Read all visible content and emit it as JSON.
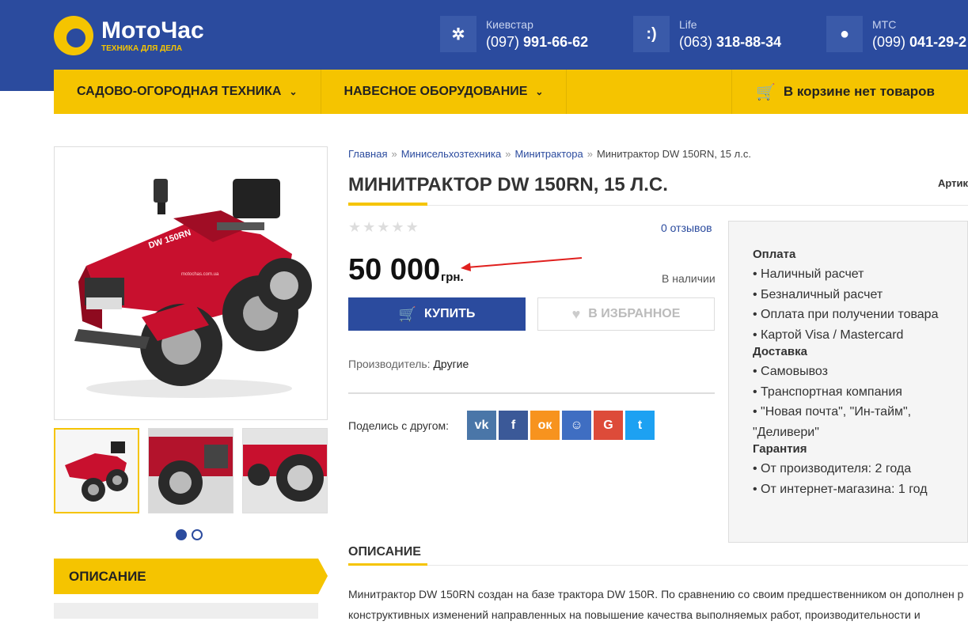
{
  "brand": {
    "name": "МотоЧас",
    "slogan": "Техника для дела"
  },
  "phones": [
    {
      "operator": "Киевстар",
      "code": "(097)",
      "number": "991-66-62",
      "icon": "kyivstar-icon",
      "glyph": "✲"
    },
    {
      "operator": "Life",
      "code": "(063)",
      "number": "318-88-34",
      "icon": "life-icon",
      "glyph": ":)"
    },
    {
      "operator": "МТС",
      "code": "(099)",
      "number": "041-29-2",
      "icon": "mts-icon",
      "glyph": "●"
    }
  ],
  "nav": {
    "item1": "Садово-огородная техника",
    "item2": "Навесное оборудование",
    "cart": "В корзине нет товаров"
  },
  "breadcrumb": {
    "home": "Главная",
    "cat": "Минисельхозтехника",
    "sub": "Минитрактора",
    "current": "Минитрактор DW 150RN, 15 л.с.",
    "sep": "»"
  },
  "product": {
    "title": "Минитрактор DW 150RN, 15 л.с.",
    "sku_label": "Артику",
    "rating": 0,
    "reviews": "0 отзывов",
    "price": "50 000",
    "currency": "грн.",
    "stock": "В наличии",
    "buy": "Купить",
    "fav": "В избранное",
    "maker_label": "Производитель:",
    "maker": "Другие",
    "share_label": "Поделись с другом:",
    "image_label": "motochas.com.ua"
  },
  "share_buttons": [
    {
      "name": "vk",
      "glyph": "vk",
      "color": "#4a76a8"
    },
    {
      "name": "facebook",
      "glyph": "f",
      "color": "#3b5998"
    },
    {
      "name": "odnoklassniki",
      "glyph": "ок",
      "color": "#f7931e"
    },
    {
      "name": "moimir",
      "glyph": "☺",
      "color": "#3f6ec2"
    },
    {
      "name": "google",
      "glyph": "G",
      "color": "#dd4b39"
    },
    {
      "name": "twitter",
      "glyph": "t",
      "color": "#1da1f2"
    }
  ],
  "info": {
    "pay_title": "Оплата",
    "pay": [
      "• Наличный расчет",
      "• Безналичный расчет",
      "• Оплата при получении товара",
      "• Картой Visa / Mastercard"
    ],
    "del_title": "Доставка",
    "del": [
      "• Самовывоз",
      "• Транспортная компания",
      "• \"Новая почта\", \"Ин-тайм\",",
      "\"Деливери\""
    ],
    "war_title": "Гарантия",
    "war": [
      "• От производителя: 2 года",
      "• От интернет-магазина: 1 год"
    ]
  },
  "tabs": {
    "side": "Описание",
    "section": "Описание"
  },
  "description": [
    "Минитрактор DW 150RN создан на базе трактора DW 150R. По сравнению со своим предшественником он дополнен р",
    "конструктивных изменений направленных на повышение качества выполняемых работ, производительности и"
  ],
  "colors": {
    "brand_blue": "#2b4b9e",
    "accent_yellow": "#f5c400",
    "tractor_red": "#c8102e"
  }
}
